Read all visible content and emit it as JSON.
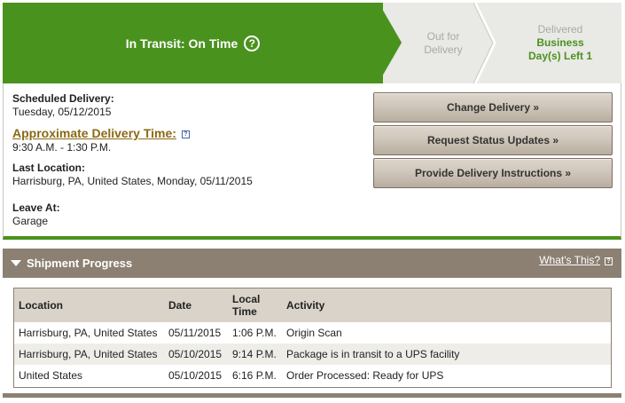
{
  "status": {
    "current_label": "In Transit: On Time",
    "help_glyph": "?",
    "steps": [
      {
        "line1": "Out for",
        "line2": "Delivery"
      },
      {
        "line1": "Delivered",
        "line2": "Business",
        "line3": "Day(s) Left 1"
      }
    ],
    "colors": {
      "active": "#4a921e",
      "inactive_bg": "#e9e9e6",
      "inactive_text": "#a9a9a3"
    }
  },
  "details": {
    "scheduled_label": "Scheduled Delivery:",
    "scheduled_value": "Tuesday, 05/12/2015",
    "approx_label": "Approximate Delivery Time:",
    "approx_value": "9:30 A.M. - 1:30 P.M.",
    "last_location_label": "Last Location:",
    "last_location_value": "Harrisburg, PA, United States, Monday, 05/11/2015",
    "leave_at_label": "Leave At:",
    "leave_at_value": "Garage",
    "help_glyph": "?"
  },
  "actions": {
    "change_delivery": "Change Delivery »",
    "request_updates": "Request Status Updates »",
    "delivery_instructions": "Provide Delivery Instructions »"
  },
  "progress": {
    "title": "Shipment Progress",
    "whats_this": "What's This?",
    "help_glyph": "?",
    "columns": [
      "Location",
      "Date",
      "Local Time",
      "Activity"
    ],
    "rows": [
      {
        "location": "Harrisburg, PA, United States",
        "date": "05/11/2015",
        "time": "1:06 P.M.",
        "activity": "Origin Scan"
      },
      {
        "location": "Harrisburg, PA, United States",
        "date": "05/10/2015",
        "time": "9:14 P.M.",
        "activity": "Package is in transit to a UPS facility"
      },
      {
        "location": "United States",
        "date": "05/10/2015",
        "time": "6:16 P.M.",
        "activity": "Order Processed: Ready for UPS"
      }
    ],
    "colors": {
      "header": "#8c8072",
      "column_header": "#d9d3ca",
      "alt_row": "#efede8"
    }
  }
}
